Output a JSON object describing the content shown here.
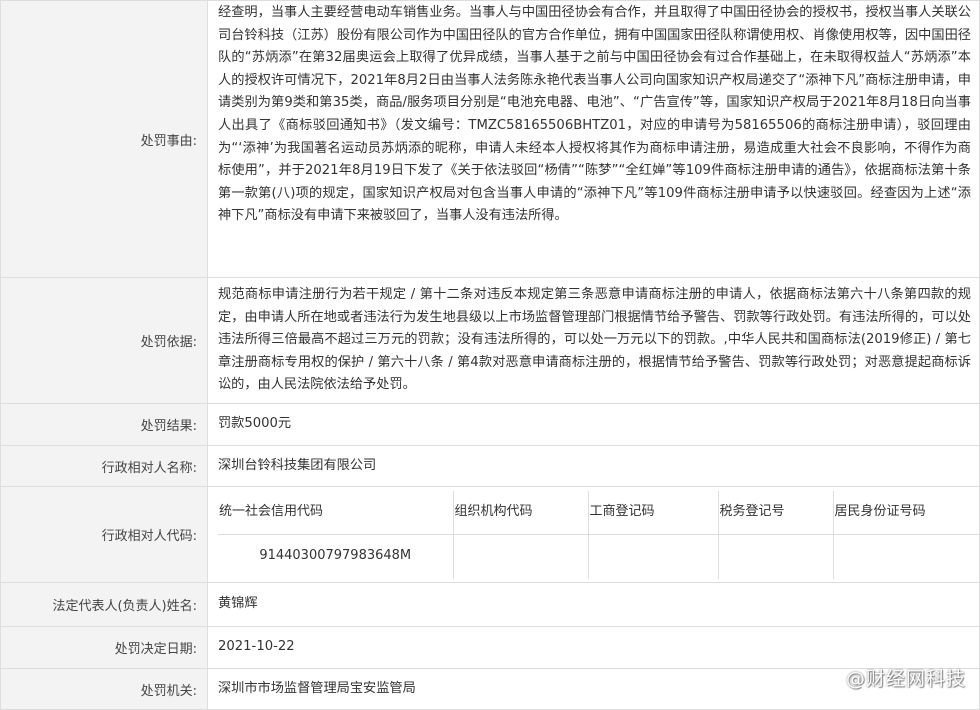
{
  "rows": {
    "reason": {
      "label": "处罚事由:",
      "text": "经查明，当事人主要经营电动车销售业务。当事人与中国田径协会有合作，并且取得了中国田径协会的授权书，授权当事人关联公司台铃科技（江苏）股份有限公司作为中国田径队的官方合作单位，拥有中国国家田径队称谓使用权、肖像使用权等，因中国田径队的“苏炳添”在第32届奥运会上取得了优异成绩，当事人基于之前与中国田径协会有过合作基础上，在未取得权益人“苏炳添”本人的授权许可情况下，2021年8月2日由当事人法务陈永艳代表当事人公司向国家知识产权局递交了“添神下凡”商标注册申请，申请类别为第9类和第35类，商品/服务项目分别是“电池充电器、电池”、“广告宣传”等，国家知识产权局于2021年8月18日向当事人出具了《商标驳回通知书》（发文编号：TMZC58165506BHTZ01，对应的申请号为58165506的商标注册申请），驳回理由为“‘添神’为我国著名运动员苏炳添的昵称，申请人未经本人授权将其作为商标申请注册，易造成重大社会不良影响，不得作为商标使用”，并于2021年8月19日下发了《关于依法驳回“杨倩”“陈梦”“全红婵”等109件商标注册申请的通告》，依据商标法第十条第一款第(八)项的规定，国家知识产权局对包含当事人申请的“添神下凡”等109件商标注册申请予以快速驳回。经查因为上述“添神下凡”商标没有申请下来被驳回了，当事人没有违法所得。"
    },
    "basis": {
      "label": "处罚依据:",
      "text": "规范商标申请注册行为若干规定 / 第十二条对违反本规定第三条恶意申请商标注册的申请人，依据商标法第六十八条第四款的规定，由申请人所在地或者违法行为发生地县级以上市场监督管理部门根据情节给予警告、罚款等行政处罚。有违法所得的，可以处违法所得三倍最高不超过三万元的罚款；没有违法所得的，可以处一万元以下的罚款。,中华人民共和国商标法(2019修正) / 第七章注册商标专用权的保护 / 第六十八条 / 第4款对恶意申请商标注册的，根据情节给予警告、罚款等行政处罚；对恶意提起商标诉讼的，由人民法院依法给予处罚。"
    },
    "result": {
      "label": "处罚结果:",
      "text": "罚款5000元"
    },
    "party_name": {
      "label": "行政相对人名称:",
      "text": "深圳台铃科技集团有限公司"
    },
    "party_code": {
      "label": "行政相对人代码:",
      "headers": [
        "统一社会信用代码",
        "组织机构代码",
        "工商登记码",
        "税务登记号",
        "居民身份证号码"
      ],
      "values": [
        "91440300797983648M",
        "",
        "",
        "",
        ""
      ]
    },
    "legal_rep": {
      "label": "法定代表人(负责人)姓名:",
      "text": "黄锦辉"
    },
    "decision_date": {
      "label": "处罚决定日期:",
      "text": "2021-10-22"
    },
    "authority": {
      "label": "处罚机关:",
      "text": "深圳市市场监督管理局宝安监管局"
    }
  },
  "watermark": {
    "text": "@财经网科技",
    "icon": "weibo-logo-icon"
  }
}
